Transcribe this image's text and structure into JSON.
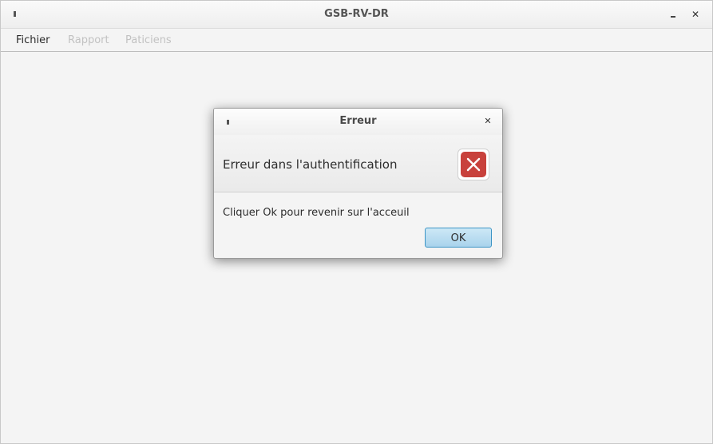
{
  "window": {
    "title": "GSB-RV-DR"
  },
  "menubar": {
    "items": [
      {
        "label": "Fichier",
        "enabled": true
      },
      {
        "label": "Rapport",
        "enabled": false
      },
      {
        "label": "Paticiens",
        "enabled": false
      }
    ]
  },
  "dialog": {
    "title": "Erreur",
    "header_text": "Erreur dans l'authentification",
    "content_text": "Cliquer Ok pour revenir sur l'acceuil",
    "ok_label": "OK",
    "icon": "error-icon"
  },
  "colors": {
    "error_red": "#c8413c",
    "button_blue": "#a9d3ec",
    "button_border": "#3c94c5"
  }
}
